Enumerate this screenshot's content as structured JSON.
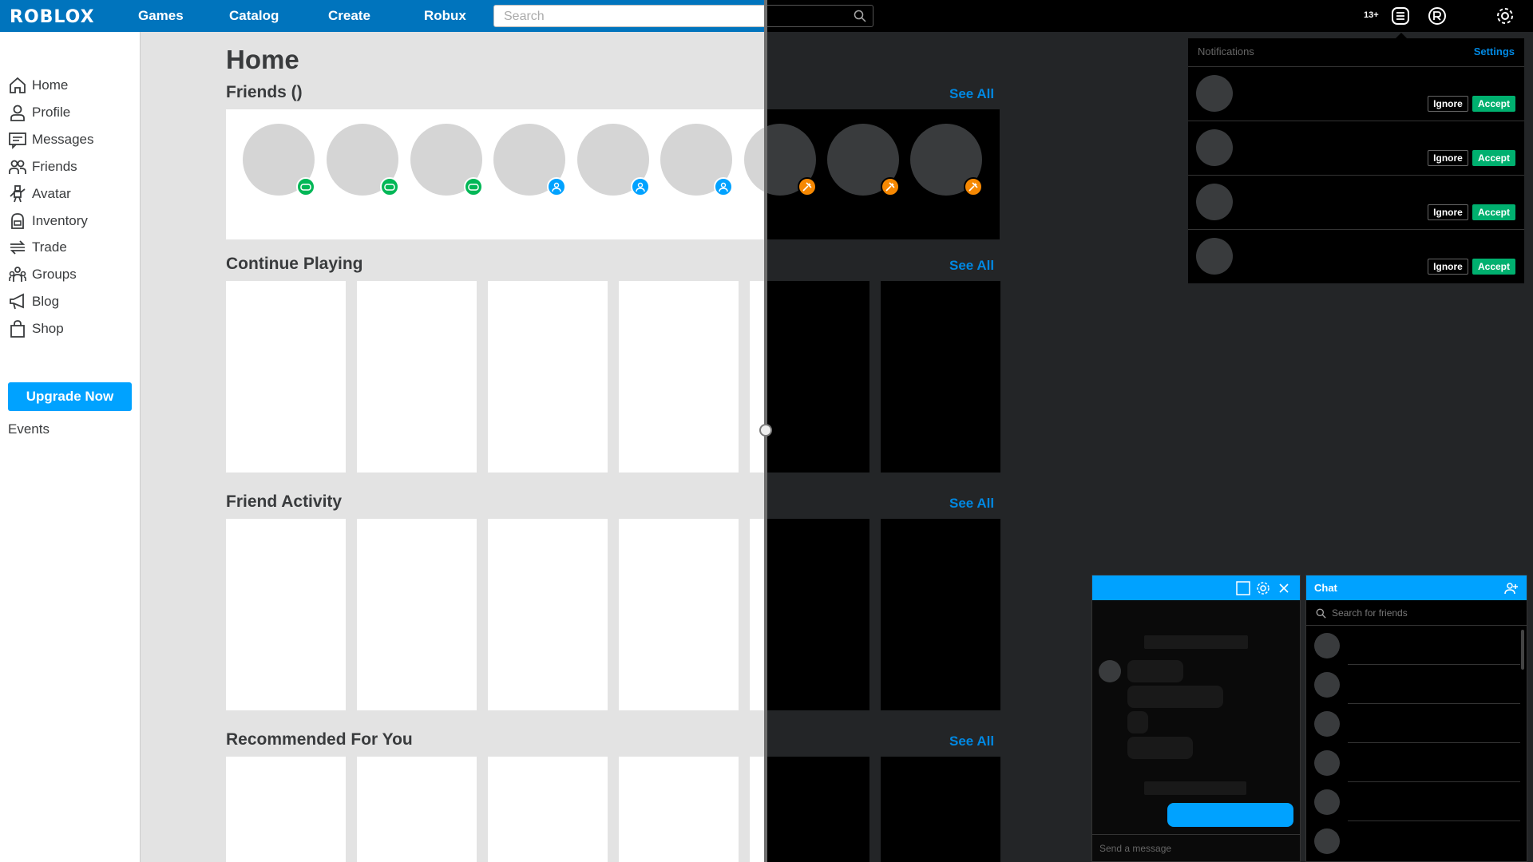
{
  "brand": {
    "logo": "ROBLOX"
  },
  "nav": {
    "games": "Games",
    "catalog": "Catalog",
    "create": "Create",
    "robux": "Robux",
    "search_placeholder": "Search"
  },
  "header_right": {
    "age_badge": "13+"
  },
  "sidebar": {
    "items": [
      {
        "label": "Home",
        "icon": "home-icon"
      },
      {
        "label": "Profile",
        "icon": "profile-icon"
      },
      {
        "label": "Messages",
        "icon": "messages-icon"
      },
      {
        "label": "Friends",
        "icon": "friends-icon"
      },
      {
        "label": "Avatar",
        "icon": "avatar-icon"
      },
      {
        "label": "Inventory",
        "icon": "inventory-icon"
      },
      {
        "label": "Trade",
        "icon": "trade-icon"
      },
      {
        "label": "Groups",
        "icon": "groups-icon"
      },
      {
        "label": "Blog",
        "icon": "blog-icon"
      },
      {
        "label": "Shop",
        "icon": "shop-icon"
      }
    ],
    "upgrade": "Upgrade Now",
    "events": "Events"
  },
  "main": {
    "title": "Home",
    "friends_heading": "Friends ()",
    "continue_heading": "Continue Playing",
    "activity_heading": "Friend Activity",
    "recommended_heading": "Recommended For You",
    "see_all": "See All",
    "friend_status": [
      "in-game",
      "in-game",
      "in-game",
      "online",
      "online",
      "online",
      "in-studio",
      "in-studio",
      "in-studio"
    ]
  },
  "notifications": {
    "title": "Notifications",
    "settings": "Settings",
    "ignore": "Ignore",
    "accept": "Accept",
    "count": 4
  },
  "conversation": {
    "placeholder": "Send a message"
  },
  "chat": {
    "title": "Chat",
    "search_placeholder": "Search for friends"
  },
  "colors": {
    "light_topbar": "#0074bd",
    "accent": "#00a2ff",
    "in_game": "#02b757",
    "online": "#00a2ff",
    "in_studio": "#f68802",
    "accept_green": "#00b06f",
    "link_blue": "#0088e2"
  }
}
